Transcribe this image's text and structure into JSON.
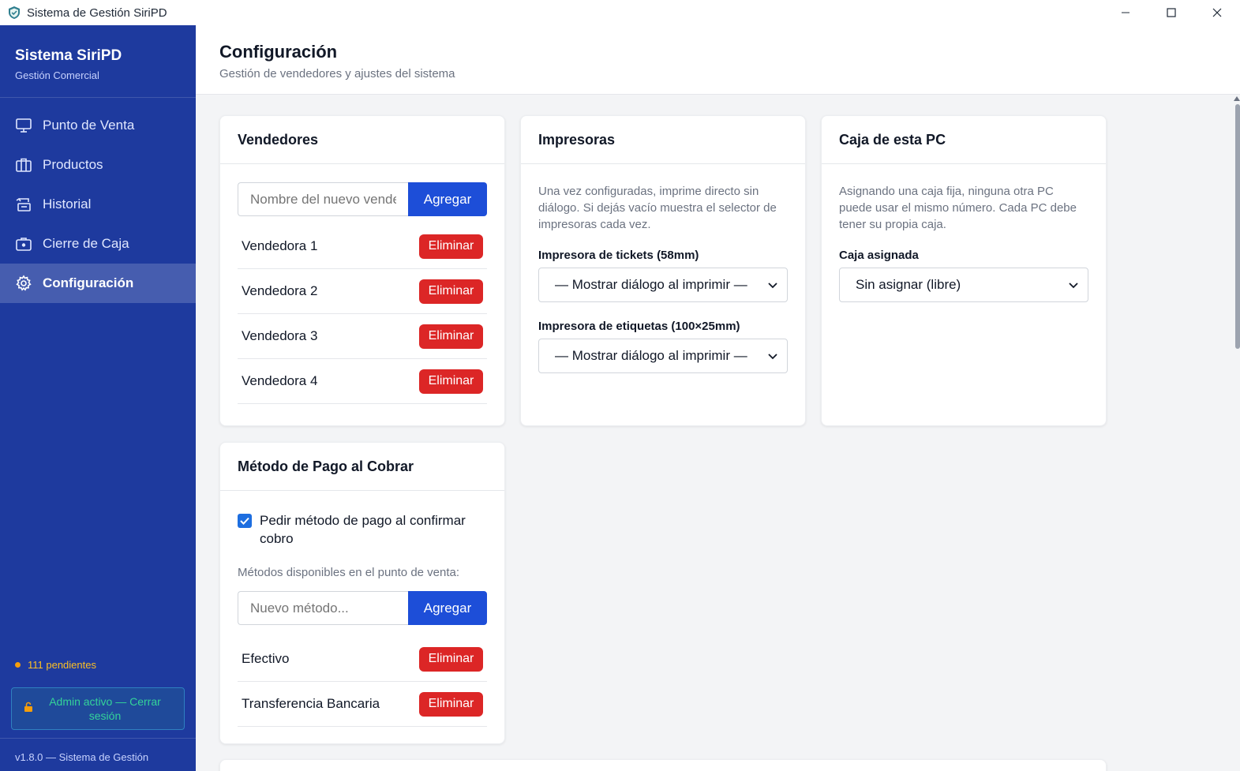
{
  "window": {
    "title": "Sistema de Gestión SiriPD"
  },
  "sidebar": {
    "brand_title": "Sistema SiriPD",
    "brand_subtitle": "Gestión Comercial",
    "items": [
      {
        "label": "Punto de Venta",
        "icon": "monitor-icon"
      },
      {
        "label": "Productos",
        "icon": "box-icon"
      },
      {
        "label": "Historial",
        "icon": "history-icon"
      },
      {
        "label": "Cierre de Caja",
        "icon": "cash-register-icon"
      },
      {
        "label": "Configuración",
        "icon": "gear-icon",
        "active": true
      }
    ],
    "pending_label": "111 pendientes",
    "admin_button_label": "Admin activo — Cerrar sesión",
    "footer": "v1.8.0 — Sistema de Gestión"
  },
  "header": {
    "title": "Configuración",
    "subtitle": "Gestión de vendedores y ajustes del sistema"
  },
  "vendedores": {
    "title": "Vendedores",
    "input_placeholder": "Nombre del nuevo vendedor",
    "add_label": "Agregar",
    "delete_label": "Eliminar",
    "items": [
      "Vendedora 1",
      "Vendedora 2",
      "Vendedora 3",
      "Vendedora 4"
    ]
  },
  "impresoras": {
    "title": "Impresoras",
    "help": "Una vez configuradas, imprime directo sin diálogo. Si dejás vacío muestra el selector de impresoras cada vez.",
    "tickets_label": "Impresora de tickets (58mm)",
    "tickets_value": "— Mostrar diálogo al imprimir —",
    "etiquetas_label": "Impresora de etiquetas (100×25mm)",
    "etiquetas_value": "— Mostrar diálogo al imprimir —"
  },
  "caja": {
    "title": "Caja de esta PC",
    "help": "Asignando una caja fija, ninguna otra PC puede usar el mismo número. Cada PC debe tener su propia caja.",
    "label": "Caja asignada",
    "value": "Sin asignar (libre)"
  },
  "metodo_pago": {
    "title": "Método de Pago al Cobrar",
    "checkbox_label": "Pedir método de pago al confirmar cobro",
    "checked": true,
    "available_label": "Métodos disponibles en el punto de venta:",
    "input_placeholder": "Nuevo método...",
    "add_label": "Agregar",
    "delete_label": "Eliminar",
    "items": [
      "Efectivo",
      "Transferencia Bancaria"
    ]
  },
  "colors": {
    "sidebar": "#1e3a9e",
    "primary": "#1d4ed8",
    "danger": "#dc2626",
    "pending": "#f59e0b",
    "admin_text": "#34d399"
  }
}
